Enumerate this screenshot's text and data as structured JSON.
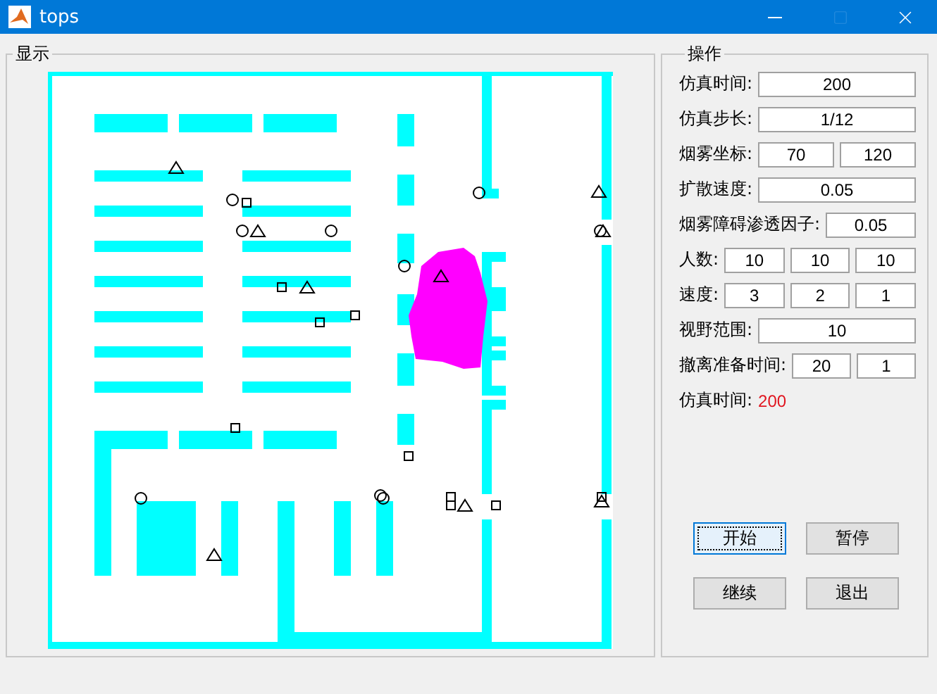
{
  "window": {
    "title": "tops",
    "controls": [
      {
        "kind": "minimize",
        "disabled": false
      },
      {
        "kind": "maximize",
        "disabled": true
      },
      {
        "kind": "close",
        "disabled": false
      }
    ]
  },
  "display_panel": {
    "title": "显示"
  },
  "control_panel": {
    "title": "操作",
    "rows": [
      {
        "label": "仿真时间:",
        "fields": [
          "200"
        ]
      },
      {
        "label": "仿真步长:",
        "fields": [
          "1/12"
        ]
      },
      {
        "label": "烟雾坐标:",
        "fields": [
          "70",
          "120"
        ]
      },
      {
        "label": "扩散速度:",
        "fields": [
          "0.05"
        ]
      },
      {
        "label": "烟雾障碍渗透因子:",
        "fields": [
          "0.05"
        ]
      },
      {
        "label": "人数:",
        "fields": [
          "10",
          "10",
          "10"
        ]
      },
      {
        "label": "速度:",
        "fields": [
          "3",
          "2",
          "1"
        ]
      },
      {
        "label": "视野范围:",
        "fields": [
          "10"
        ]
      },
      {
        "label": "撤离准备时间:",
        "fields": [
          "20",
          "1"
        ]
      }
    ],
    "status": {
      "label": "仿真时间:",
      "value": "200"
    },
    "buttons": [
      {
        "label": "开始",
        "focused": true
      },
      {
        "label": "暂停",
        "focused": false
      },
      {
        "label": "继续",
        "focused": false
      },
      {
        "label": "退出",
        "focused": false
      }
    ]
  }
}
